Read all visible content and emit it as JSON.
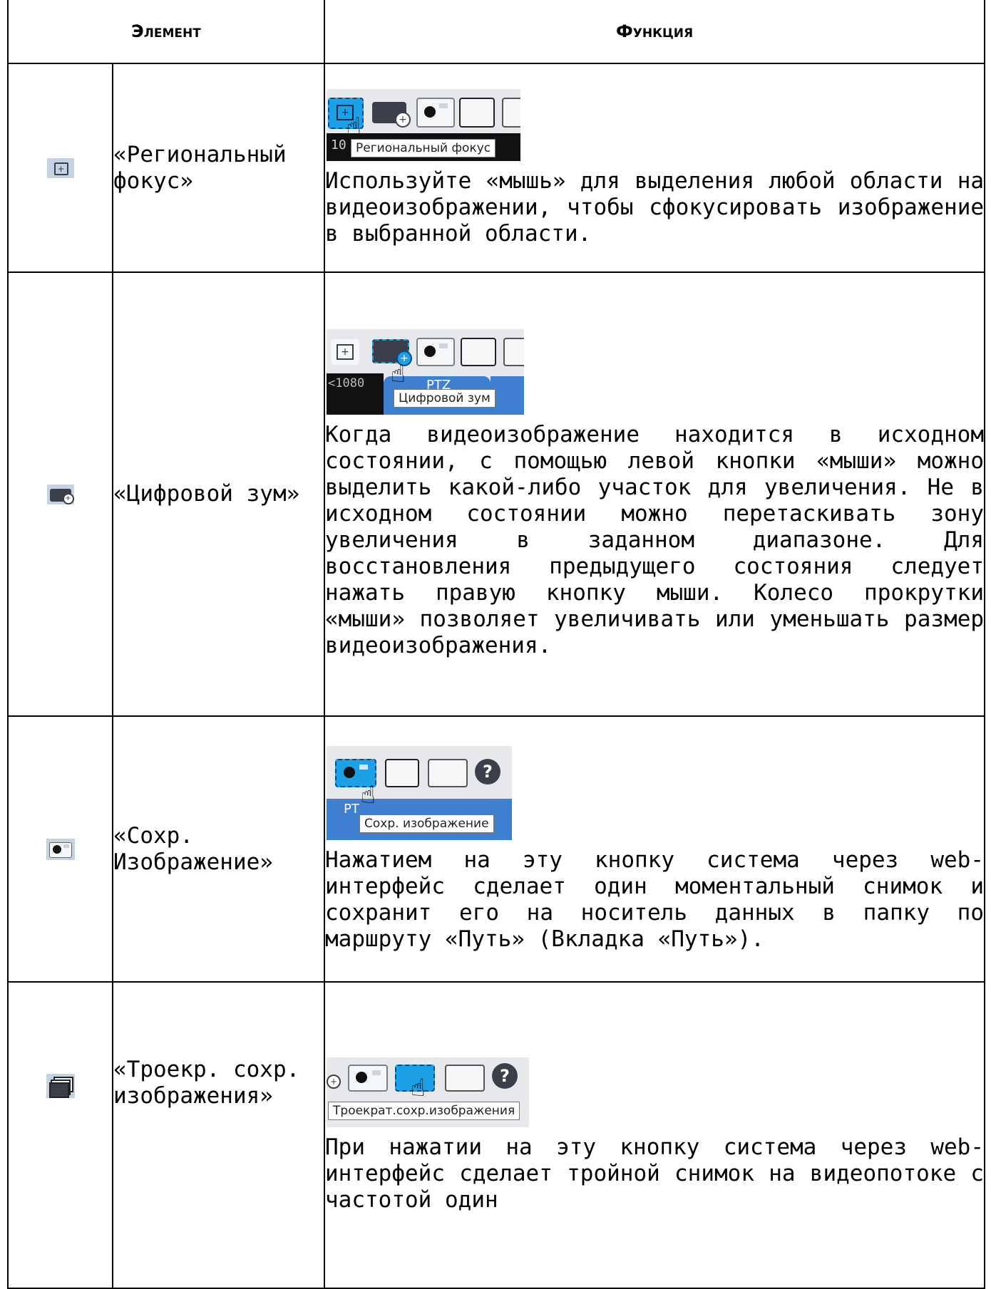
{
  "table": {
    "header": {
      "element": "Элемент",
      "function": "Функция"
    },
    "rows": [
      {
        "icon": "region-focus-icon",
        "name": "«Региональный фокус»",
        "tooltip": "Региональный фокус",
        "overlay": "10",
        "description": "Используйте «мышь» для выделения любой области на видеоизображении, чтобы сфокусировать изображение в выбранной области."
      },
      {
        "icon": "digital-zoom-icon",
        "name": "«Цифровой зум»",
        "tooltip": "Цифровой зум",
        "overlay": "<1080",
        "tab_label": "PTZ",
        "description": "Когда видеоизображение находится в исходном состоянии, с помощью левой кнопки «мыши» можно выделить какой-либо участок для увеличения. Не в исходном состоянии можно перетаскивать зону увеличения в заданном диапазоне. Для восстановления предыдущего состояния следует нажать правую кнопку мыши. Колесо прокрутки «мыши» позволяет увеличивать или уменьшать размер видеоизображения."
      },
      {
        "icon": "snapshot-icon",
        "name": "«Сохр. Изображение»",
        "tooltip": "Сохр. изображение",
        "tab_label": "PT",
        "description": "Нажатием на эту кнопку система через web-интерфейс сделает один моментальный снимок и сохранит его на носитель данных в папку по маршруту «Путь» (Вкладка «Путь»)."
      },
      {
        "icon": "triple-snapshot-icon",
        "name": "«Троекр. сохр. изображения»",
        "tooltip": "Троекрат.сохр.изображения",
        "description": "При нажатии на эту кнопку система через web-интерфейс сделает тройной снимок на видеопотоке с частотой один"
      }
    ]
  },
  "colors": {
    "border": "#000000",
    "toolbar_bg": "#e6e8ec",
    "highlight": "#1ea0e6",
    "button_dark": "#3a3f4a",
    "tab_blue": "#3f7fd0"
  }
}
